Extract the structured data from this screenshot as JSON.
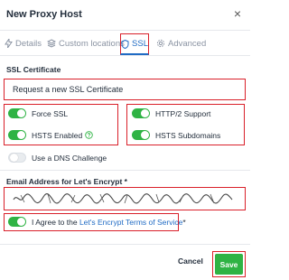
{
  "dialog": {
    "title": "New Proxy Host",
    "close_glyph": "×"
  },
  "tabs": [
    {
      "label": "Details",
      "icon": "zap-icon",
      "active": false
    },
    {
      "label": "Custom locations",
      "icon": "layers-icon",
      "active": false
    },
    {
      "label": "SSL",
      "icon": "shield-icon",
      "active": true
    },
    {
      "label": "Advanced",
      "icon": "gear-icon",
      "active": false
    }
  ],
  "ssl_certificate": {
    "label": "SSL Certificate",
    "selected": "Request a new SSL Certificate"
  },
  "toggles": {
    "force_ssl": {
      "label": "Force SSL",
      "on": true
    },
    "http2": {
      "label": "HTTP/2 Support",
      "on": true
    },
    "hsts_enabled": {
      "label": "HSTS Enabled",
      "on": true
    },
    "hsts_subdomains": {
      "label": "HSTS Subdomains",
      "on": true
    },
    "dns_challenge": {
      "label": "Use a DNS Challenge",
      "on": false
    }
  },
  "email": {
    "label": "Email Address for Let's Encrypt",
    "required_mark": "*"
  },
  "agree": {
    "prefix": "I Agree to the",
    "link_text": "Let's Encrypt Terms of Service",
    "required_mark": "*",
    "on": true
  },
  "footer": {
    "cancel_label": "Cancel",
    "save_label": "Save"
  },
  "colors": {
    "accent_blue": "#206bc4",
    "toggle_green": "#2fb344",
    "highlight_red": "#d9202a"
  }
}
